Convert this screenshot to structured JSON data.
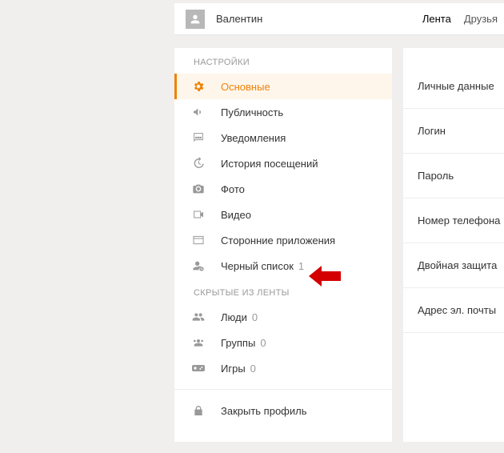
{
  "header": {
    "username": "Валентин",
    "nav": {
      "feed": "Лента",
      "friends": "Друзья"
    }
  },
  "sidebar": {
    "settings_header": "НАСТРОЙКИ",
    "items": {
      "basic": "Основные",
      "publicity": "Публичность",
      "notifications": "Уведомления",
      "history": "История посещений",
      "photo": "Фото",
      "video": "Видео",
      "apps": "Сторонние приложения",
      "blacklist": "Черный список",
      "blacklist_count": "1"
    },
    "hidden_header": "СКРЫТЫЕ ИЗ ЛЕНТЫ",
    "hidden": {
      "people": "Люди",
      "people_count": "0",
      "groups": "Группы",
      "groups_count": "0",
      "games": "Игры",
      "games_count": "0"
    },
    "lock": "Закрыть профиль"
  },
  "main": {
    "fields": {
      "personal": "Личные данные",
      "login": "Логин",
      "password": "Пароль",
      "phone": "Номер телефона",
      "double": "Двойная защита",
      "email": "Адрес эл. почты"
    }
  }
}
